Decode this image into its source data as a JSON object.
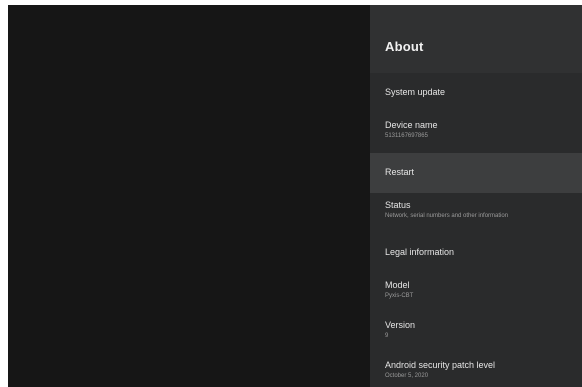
{
  "panel": {
    "title": "About"
  },
  "menu": {
    "items": [
      {
        "label": "System update",
        "sub": ""
      },
      {
        "label": "Device name",
        "sub": "5131167697865"
      },
      {
        "label": "Restart",
        "sub": ""
      },
      {
        "label": "Status",
        "sub": "Network, serial numbers and other information"
      },
      {
        "label": "Legal information",
        "sub": ""
      },
      {
        "label": "Model",
        "sub": "Pyxis-CBT"
      },
      {
        "label": "Version",
        "sub": "9"
      },
      {
        "label": "Android security patch level",
        "sub": "October 5, 2020"
      }
    ],
    "focused_index": 2
  },
  "colors": {
    "background": "#161616",
    "panel": "#2a2b2c",
    "header": "#303132",
    "focus": "#3d3e3f",
    "text_primary": "#e6e6e6",
    "text_secondary": "#9a9a9a"
  }
}
